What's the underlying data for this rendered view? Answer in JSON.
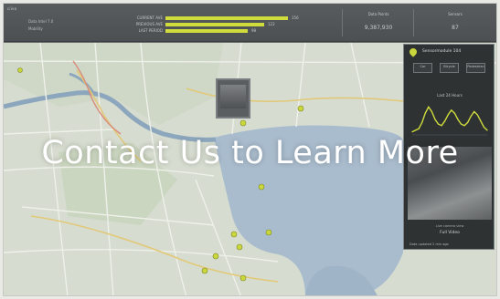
{
  "overlay": {
    "headline": "Contact Us to Learn More"
  },
  "colors": {
    "accent": "#cfdc3c",
    "water": "#a9bccd",
    "panel_bg": "#2f3233",
    "topbar_bg": "#52565a"
  },
  "icons": [
    "pin-icon",
    "camera-icon",
    "sensor-marker-icon"
  ],
  "topbar": {
    "logo": "ciivo",
    "lines": [
      "Data Intel 7.0",
      "Mobility"
    ],
    "kpis": [
      {
        "label": "CURRENT AVE",
        "fraction": 0.97,
        "value": "156"
      },
      {
        "label": "PREVIOUS AVE",
        "fraction": 0.78,
        "value": "122"
      },
      {
        "label": "LAST PERIOD",
        "fraction": 0.65,
        "value": "98"
      }
    ],
    "stats": [
      {
        "label": "Data Points",
        "value": "9,387,930"
      },
      {
        "label": "Sensors",
        "value": "87"
      }
    ]
  },
  "panel": {
    "title": "Sensormodule 104",
    "buttons": [
      "Car",
      "Bicycle",
      "Pedestrian"
    ],
    "chart_title": "Last 24 Hours",
    "camera_caption": "Live camera view",
    "camera_button": "Full Video",
    "footer": "Data updated 2 min ago"
  },
  "chart_data": {
    "type": "line",
    "title": "Last 24 Hours",
    "x": [
      0,
      1,
      2,
      3,
      4,
      5,
      6,
      7,
      8,
      9,
      10,
      11,
      12,
      13,
      14,
      15,
      16,
      17,
      18,
      19,
      20,
      21,
      22,
      23
    ],
    "series": [
      {
        "values": [
          2,
          3,
          4,
          8,
          14,
          18,
          15,
          10,
          7,
          6,
          9,
          13,
          16,
          14,
          10,
          7,
          6,
          8,
          12,
          15,
          13,
          9,
          5,
          3
        ]
      }
    ],
    "ylim": [
      0,
      20
    ]
  }
}
